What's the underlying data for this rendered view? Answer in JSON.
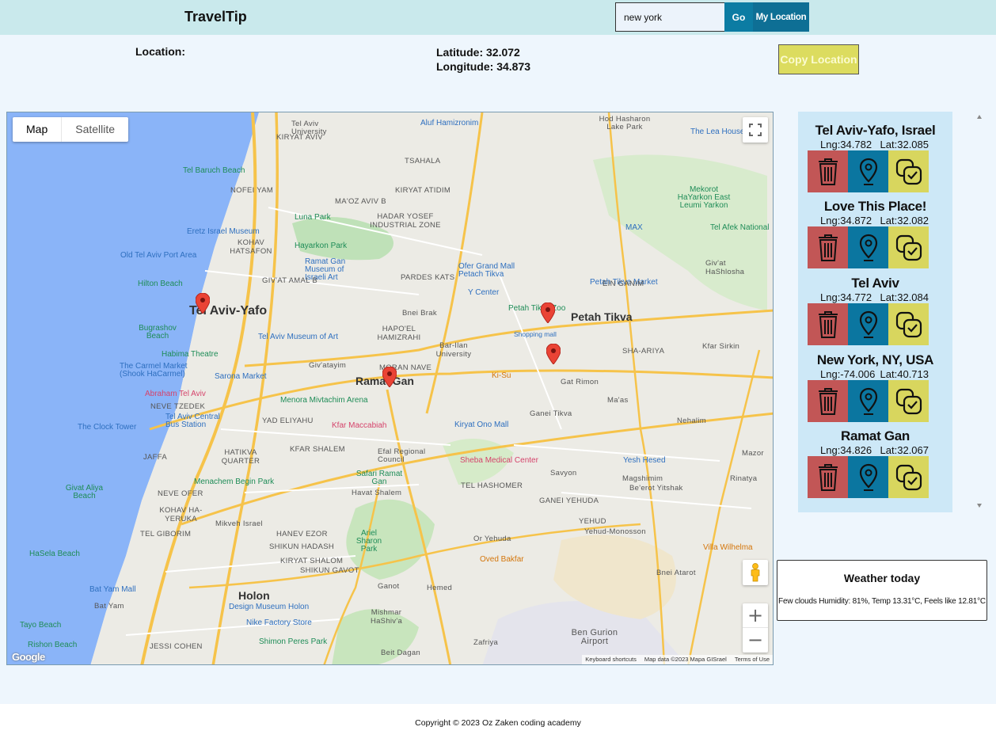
{
  "header": {
    "brand": "TravelTip",
    "search_value": "new york",
    "go_label": "Go",
    "my_location_label": "My Location"
  },
  "info": {
    "location_label": "Location:",
    "latitude": "Latitude: 32.072",
    "longitude": "Longitude: 34.873",
    "copy_label": "Copy Location"
  },
  "map": {
    "type_map": "Map",
    "type_satellite": "Satellite",
    "zoom_in": "+",
    "zoom_out": "−",
    "google": "Google",
    "attrib": [
      "Keyboard shortcuts",
      "Map data ©2023 Mapa GISrael",
      "Terms of Use"
    ],
    "cities": [
      "Tel Aviv-Yafo",
      "Ramat Gan",
      "Petah Tikva",
      "Holon"
    ],
    "places": [
      "Tel Baruch Beach",
      "Luna Park",
      "Eretz Israel Museum",
      "Hayarkon Park",
      "Old Tel Aviv Port Area",
      "Ramat Gan Museum of Israeli Art",
      "Hilton Beach",
      "Tel Aviv University",
      "Ofer Grand Mall Petach Tikva",
      "Petah Tikva Market",
      "Y Center",
      "Petah Tikva Zoo",
      "Bugrashov Beach",
      "Tel Aviv Museum of Art",
      "Habima Theatre",
      "The Carmel Market (Shook HaCarmel)",
      "Sarona Market",
      "Abraham Tel Aviv",
      "Menora Mivtachim Arena",
      "The Clock Tower",
      "Tel Aviv Central Bus Station",
      "Kfar Maccabiah",
      "Kiryat Ono Mall",
      "Ki-Su",
      "Sheba Medical Center",
      "Efal Regional Council",
      "Safari Ramat Gan",
      "Menachem Begin Park",
      "Yesh Hesed",
      "Givat Aliya Beach",
      "HaSela Beach",
      "Ariel Sharon Park",
      "Oved Bakfar",
      "Villa Wilhelma",
      "Bat Yam Mall",
      "Design Museum Holon",
      "Nike Factory Store",
      "Shimon Peres Park",
      "Tayo Beach",
      "Ben Gurion Airport",
      "Aluf Hamizronim",
      "Hod Hasharon Lake Park",
      "The Lea House",
      "Mekorot HaYarkon East Leumi Yarkon",
      "Tel Afek National",
      "MAX",
      "Rishon Beach",
      "Shopping mall"
    ],
    "areas": [
      "NOFEI YAM",
      "KIRYAT ATIDIM",
      "HADAR YOSEF INDUSTRIAL ZONE",
      "KOHAV HATSAFON",
      "GIV'AT AMAL B",
      "PARDES KATS",
      "Bnei Brak",
      "HAPO'EL HAMIZRAHI",
      "EIN GANIM",
      "SHA-ARIYA",
      "Kfar Sirkin",
      "Giv'atayim",
      "MORAN NAVE",
      "Bar-Ilan University",
      "Gat Rimon",
      "NEVE TZEDEK",
      "YAD ELIYAHU",
      "Ganei Tikva",
      "Ma'as",
      "JAFFA",
      "HATIKVA QUARTER",
      "KFAR SHALEM",
      "Nehalim",
      "Savyon",
      "TEL HASHOMER",
      "Magshimim",
      "Be'erot Yitshak",
      "Rinatya",
      "NEVE OFER",
      "Havat Shalem",
      "GANEI YEHUDA",
      "KOHAV HA-YERUKA",
      "Mikveh Israel",
      "YEHUD",
      "Yehud-Monosson",
      "TEL GIBORIM",
      "HANEV EZOR",
      "SHIKUN HADASH",
      "Or Yehuda",
      "KIRYAT SHALOM",
      "SHIKUN GAVOT",
      "Ganot",
      "Hemed",
      "Bnei Atarot",
      "Bat Yam",
      "Mishmar HaShiv'a",
      "Zafriya",
      "Beit Dagan",
      "JESSI COHEN",
      "KIRYAT AVIV",
      "MA'OZ AVIV B",
      "TSAHALA",
      "Giv'at HaShlosha",
      "Mazor"
    ]
  },
  "saved_places": [
    {
      "name": "Tel Aviv-Yafo, Israel",
      "lng": "Lng:34.782",
      "lat": "Lat:32.085"
    },
    {
      "name": "Love This Place!",
      "lng": "Lng:34.872",
      "lat": "Lat:32.082"
    },
    {
      "name": "Tel Aviv",
      "lng": "Lng:34.772",
      "lat": "Lat:32.084"
    },
    {
      "name": "New York, NY, USA",
      "lng": "Lng:-74.006",
      "lat": "Lat:40.713"
    },
    {
      "name": "Ramat Gan",
      "lng": "Lng:34.826",
      "lat": "Lat:32.067"
    }
  ],
  "weather": {
    "title": "Weather today",
    "description": "Few clouds Humidity: 81%, Temp 13.31°C, Feels like 12.81°C"
  },
  "footer": {
    "copyright": "Copyright © 2023  Oz Zaken   coding academy"
  },
  "colors": {
    "header_bg": "#c9e9ec",
    "page_bg": "#eef6fd",
    "delete": "#c25656",
    "go": "#0b76a0",
    "copy": "#d8d65e",
    "list_bg": "#cde8f7"
  }
}
